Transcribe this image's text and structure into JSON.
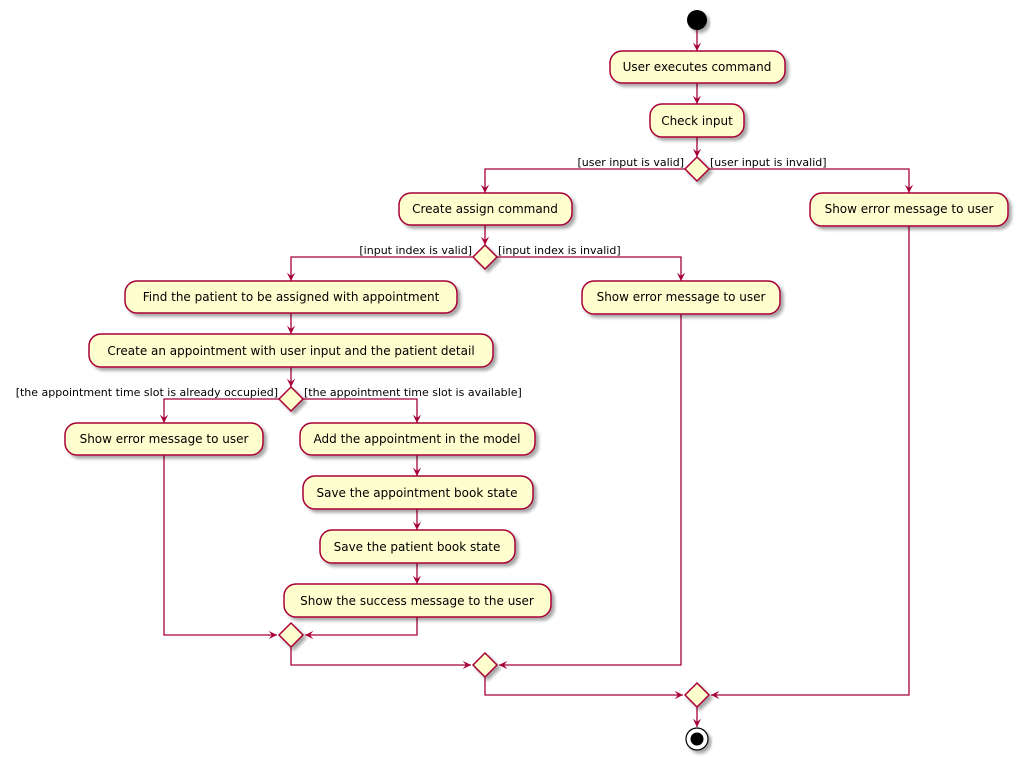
{
  "diagram": {
    "type": "activity",
    "colors": {
      "line": "#A80036",
      "fill": "#FEFECE",
      "shadow": "#999999",
      "start": "#000000"
    },
    "activities": {
      "user_executes": "User executes command",
      "check_input": "Check input",
      "create_assign": "Create assign command",
      "show_error_1": "Show error message to user",
      "find_patient": "Find the patient to be assigned with appointment",
      "show_error_2": "Show error message to user",
      "create_appointment": "Create an appointment with user input and the patient detail",
      "show_error_3": "Show error message to user",
      "add_appointment": "Add the appointment in the model",
      "save_appointment_book": "Save the appointment book state",
      "save_patient_book": "Save the patient book state",
      "show_success": "Show the success message to the user"
    },
    "guards": {
      "input_valid": "[user input is valid]",
      "input_invalid": "[user input is invalid]",
      "index_valid": "[input index is valid]",
      "index_invalid": "[input index is invalid]",
      "slot_occupied": "[the appointment time slot is already occupied]",
      "slot_available": "[the appointment time slot is available]"
    }
  }
}
